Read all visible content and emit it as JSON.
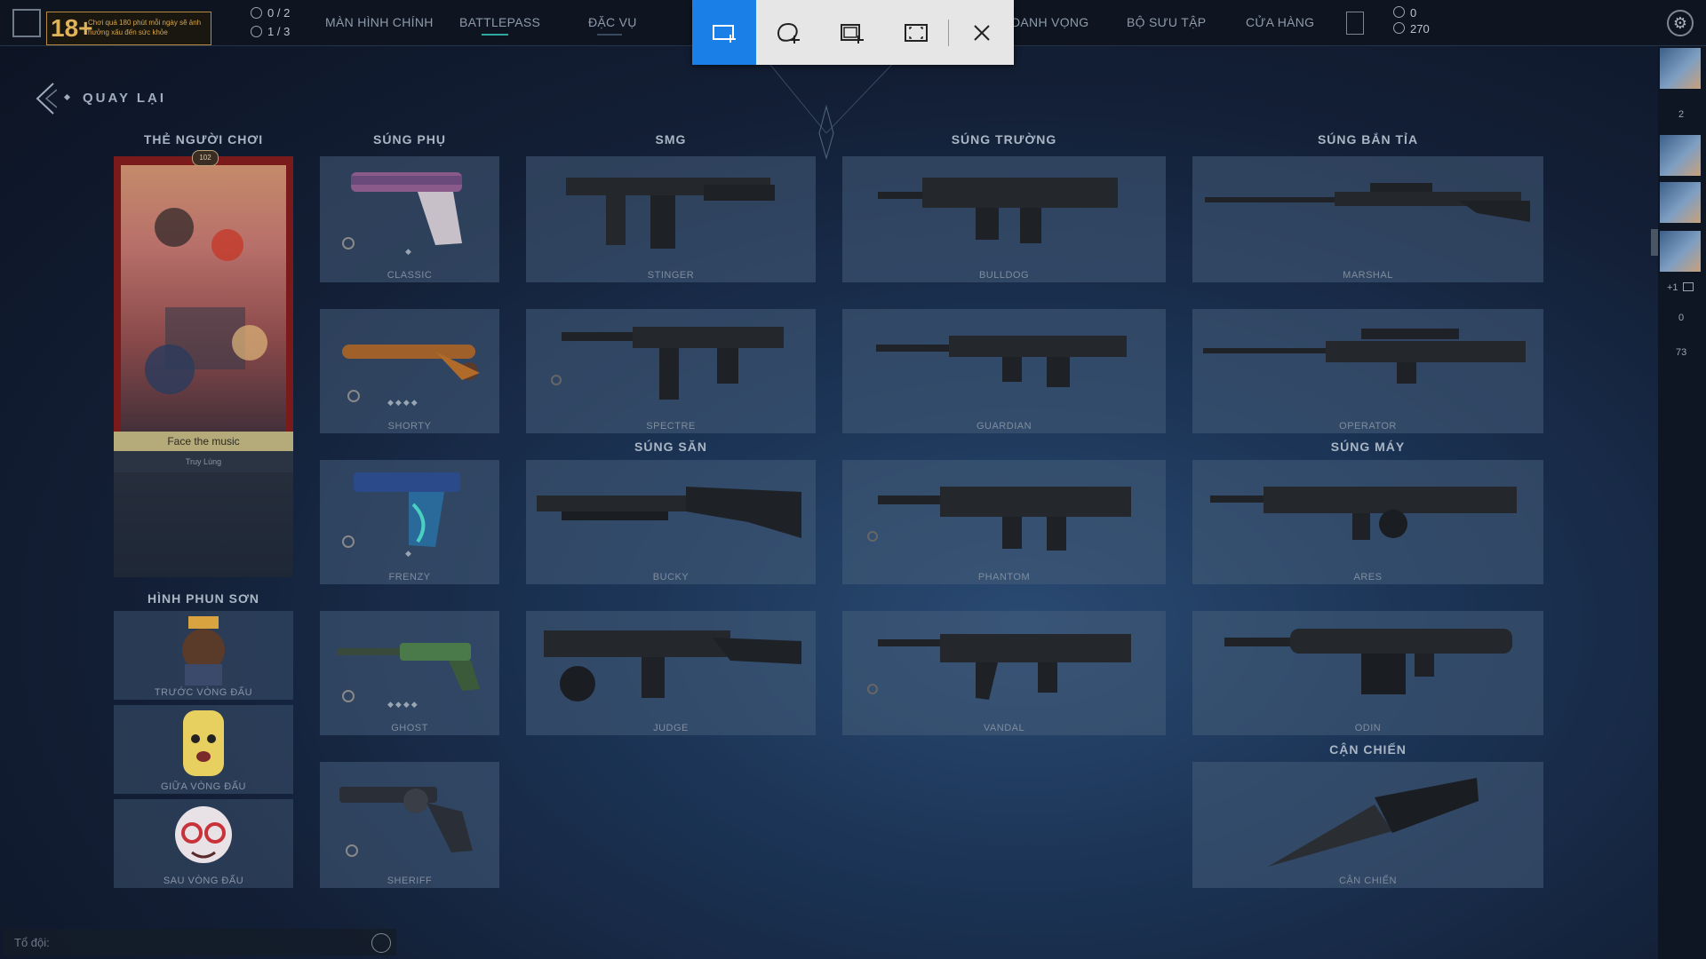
{
  "topbar": {
    "age_rating": "18+",
    "age_notice": "Chơi quá 180 phút mỗi ngày sẽ ảnh hưởng xấu đến sức khỏe",
    "counter_a": "0 / 2",
    "counter_b": "1 / 3",
    "nav": [
      "MÀN HÌNH CHÍNH",
      "BATTLEPASS",
      "ĐẶC VỤ",
      "DANH VỌNG",
      "BỘ SƯU TẬP",
      "CỬA HÀNG"
    ],
    "points_vp": "0",
    "points_rp": "270"
  },
  "back_label": "QUAY LẠI",
  "sections": {
    "player_card": "THẺ NGƯỜI CHƠI",
    "sidearm": "SÚNG PHỤ",
    "smg": "SMG",
    "rifle": "SÚNG TRƯỜNG",
    "sniper": "SÚNG BẮN TỈA",
    "shotgun": "SÚNG SĂN",
    "machine_gun": "SÚNG MÁY",
    "melee": "CẬN CHIẾN",
    "spray": "HÌNH PHUN SƠN"
  },
  "player_card": {
    "level": "102",
    "name": "Face the music",
    "title": "Truy Lùng"
  },
  "sprays": [
    "TRƯỚC VÒNG ĐẤU",
    "GIỮA VÒNG ĐẤU",
    "SAU VÒNG ĐẤU"
  ],
  "weapons": {
    "classic": "CLASSIC",
    "shorty": "SHORTY",
    "frenzy": "FRENZY",
    "ghost": "GHOST",
    "sheriff": "SHERIFF",
    "stinger": "STINGER",
    "spectre": "SPECTRE",
    "bucky": "BUCKY",
    "judge": "JUDGE",
    "bulldog": "BULLDOG",
    "guardian": "GUARDIAN",
    "phantom": "PHANTOM",
    "vandal": "VANDAL",
    "marshal": "MARSHAL",
    "operator": "OPERATOR",
    "ares": "ARES",
    "odin": "ODIN",
    "melee": "CẬN CHIẾN"
  },
  "sidebar": {
    "count_a": "2",
    "party": "+1",
    "count_b": "0",
    "count_c": "73"
  },
  "chat": {
    "placeholder": "Tổ đội:"
  },
  "colors": {
    "accent_snip": "#1a7fe6",
    "card_border": "#7a1a1a",
    "age_gold": "#e0b25a"
  }
}
